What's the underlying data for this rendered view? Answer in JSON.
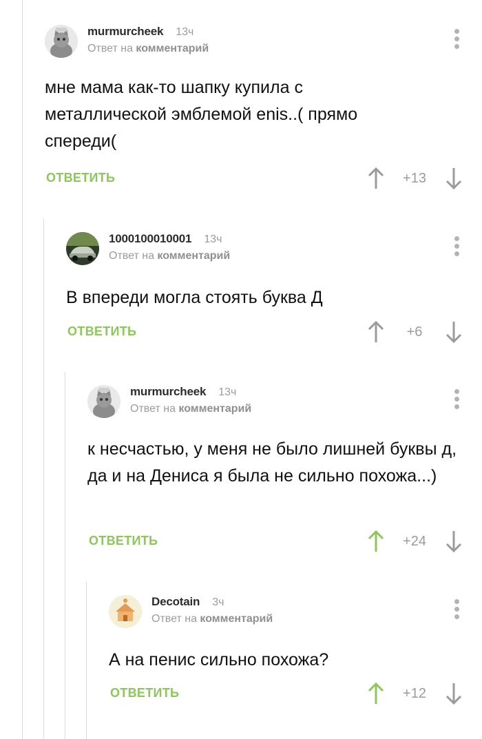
{
  "colors": {
    "accent": "#8ac858",
    "muted": "#9b9b9b",
    "line": "#d9d9d9"
  },
  "comments": [
    {
      "username": "murmurcheek",
      "time": "13ч",
      "reply_prefix": "Ответ на",
      "reply_link": "комментарий",
      "text": "мне мама как-то шапку купила с металлической эмблемой enis..( прямо спереди(",
      "reply_label": "ОТВЕТИТЬ",
      "rating": "+13",
      "upvoted": false,
      "avatar": "cat-avatar"
    },
    {
      "username": "1000100010001",
      "time": "13ч",
      "reply_prefix": "Ответ на",
      "reply_link": "комментарий",
      "text": "В впереди могла стоять буква Д",
      "reply_label": "ОТВЕТИТЬ",
      "rating": "+6",
      "upvoted": false,
      "avatar": "car-avatar"
    },
    {
      "username": "murmurcheek",
      "time": "13ч",
      "reply_prefix": "Ответ на",
      "reply_link": "комментарий",
      "text": "к несчастью, у меня не было лишней буквы д, да и на Дениса я была не сильно похожа...)",
      "reply_label": "ОТВЕТИТЬ",
      "rating": "+24",
      "upvoted": true,
      "avatar": "cat-avatar"
    },
    {
      "username": "Decotain",
      "time": "3ч",
      "reply_prefix": "Ответ на",
      "reply_link": "комментарий",
      "text": "А на пенис сильно похожа?",
      "reply_label": "ОТВЕТИТЬ",
      "rating": "+12",
      "upvoted": true,
      "avatar": "house-avatar"
    }
  ]
}
